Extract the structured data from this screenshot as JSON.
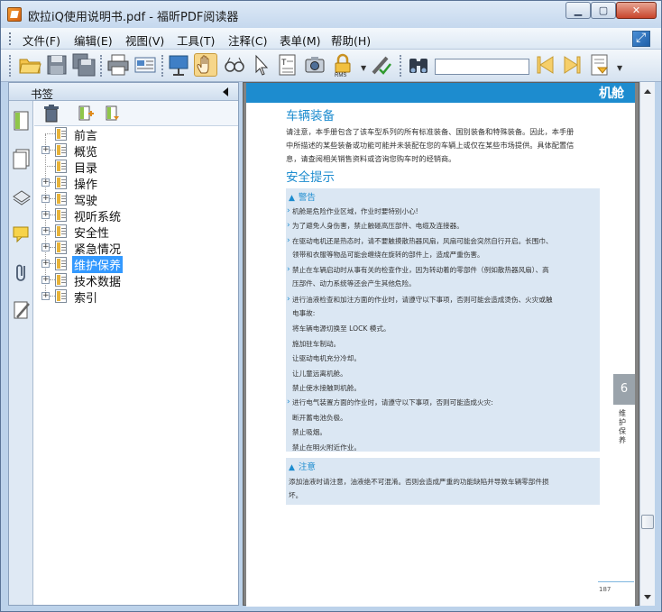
{
  "window": {
    "title": "欧拉iQ使用说明书.pdf - 福昕PDF阅读器"
  },
  "menu": [
    "文件(F)",
    "编辑(E)",
    "视图(V)",
    "工具(T)",
    "注释(C)",
    "表单(M)",
    "帮助(H)"
  ],
  "bookmarks_panel": {
    "title": "书签",
    "items": [
      {
        "label": "前言",
        "expandable": false
      },
      {
        "label": "概览",
        "expandable": true
      },
      {
        "label": "目录",
        "expandable": false
      },
      {
        "label": "操作",
        "expandable": true
      },
      {
        "label": "驾驶",
        "expandable": true
      },
      {
        "label": "视听系统",
        "expandable": true
      },
      {
        "label": "安全性",
        "expandable": true
      },
      {
        "label": "紧急情况",
        "expandable": true
      },
      {
        "label": "维护保养",
        "expandable": true,
        "selected": true
      },
      {
        "label": "技术数据",
        "expandable": true
      },
      {
        "label": "索引",
        "expandable": true
      }
    ]
  },
  "page": {
    "band_title": "机舱",
    "section1_title": "车辆装备",
    "section1_lines": [
      "请注意，本手册包含了该车型系列的所有标准装备、国别装备和特殊装备。因此，本手册",
      "中所描述的某些装备或功能可能并未装配在您的车辆上或仅在某些市场提供。具体配置信",
      "息，请查阅相关销售资料或咨询您购车时的经销商。"
    ],
    "section2_title": "安全提示",
    "warning_title": "警告",
    "warning_lines": [
      {
        "text": "机舱是危险作业区域，作业时要特别小心!",
        "bullet": true
      },
      {
        "text": "为了避免人身伤害，禁止触碰高压部件、电缆及连接器。",
        "bullet": true
      },
      {
        "text": "在驱动电机还是热态时，请不要触摸散热器风扇，风扇可能会突然自行开启。长围巾、",
        "bullet": true
      },
      {
        "text": "领带和衣服等物品可能会缠绕在旋转的部件上，造成严重伤害。",
        "bullet": false
      },
      {
        "text": "禁止在车辆启动时从事有关的检查作业，因为转动着的零部件（例如散热器风扇）、高",
        "bullet": true
      },
      {
        "text": "压部件、动力系统等还会产生其他危险。",
        "bullet": false
      },
      {
        "text": "进行油液检查和加注方面的作业时，请遵守以下事项，否则可能会造成烫伤、火灾或触",
        "bullet": true
      },
      {
        "text": "电事故:",
        "bullet": false
      },
      {
        "text": "将车辆电源切换至 LOCK 模式。",
        "bullet": false
      },
      {
        "text": "施加驻车制动。",
        "bullet": false
      },
      {
        "text": "让驱动电机充分冷却。",
        "bullet": false
      },
      {
        "text": "让儿童远离机舱。",
        "bullet": false
      },
      {
        "text": "禁止使水接触到机舱。",
        "bullet": false
      },
      {
        "text": "进行电气装置方面的作业时，请遵守以下事项，否则可能造成火灾:",
        "bullet": true
      },
      {
        "text": "断开蓄电池负极。",
        "bullet": false
      },
      {
        "text": "禁止吸烟。",
        "bullet": false
      },
      {
        "text": "禁止在明火附近作业。",
        "bullet": false
      }
    ],
    "note_title": "注意",
    "note_lines": [
      "添加油液时请注意，油液绝不可混淆。否则会造成严重的功能缺陷并导致车辆零部件损",
      "坏。"
    ],
    "chapter_number": "6",
    "chapter_label": "维护保养",
    "page_number": "187"
  },
  "colors": {
    "accent": "#1d8ccf",
    "selection": "#3399ff",
    "warning_box": "#dbe7f3"
  }
}
